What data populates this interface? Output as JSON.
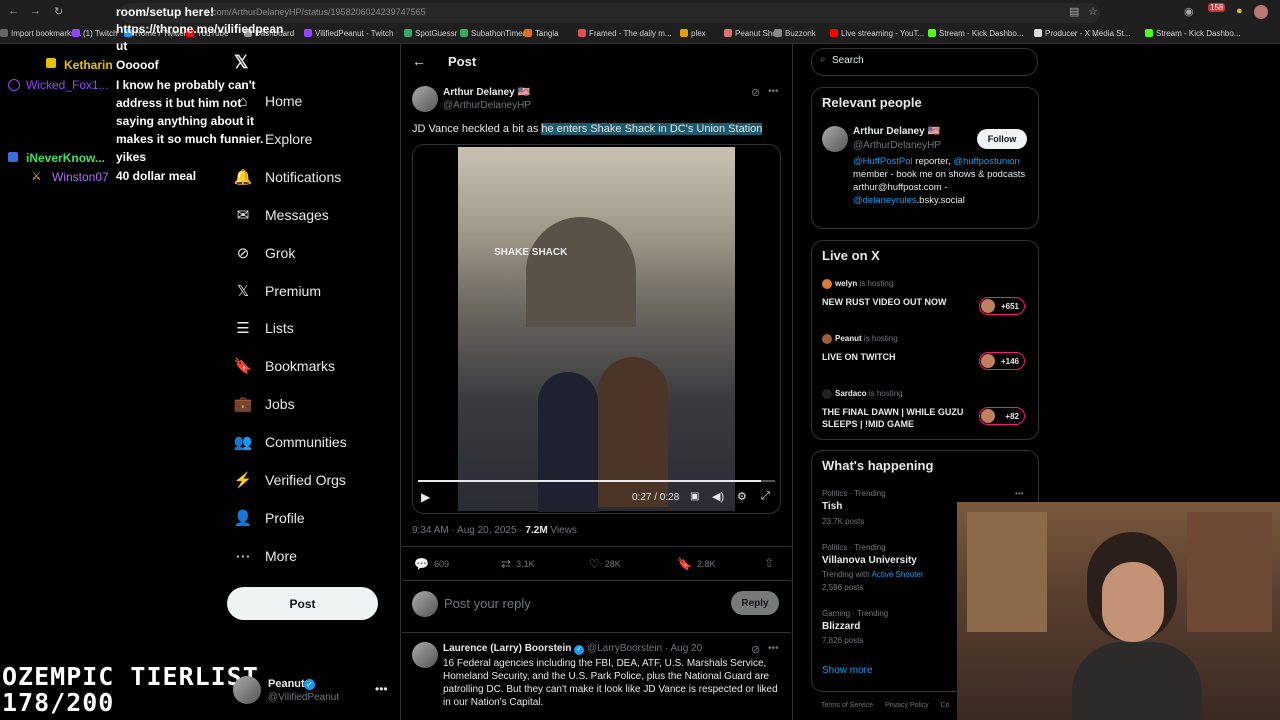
{
  "browser": {
    "url": "x.com/ArthurDelaneyHP/status/1958206024239747565",
    "bookmarks": [
      "Import bookmarks...",
      "(1) Twitch",
      "Home / Twitter",
      "YouTube",
      "Dashboard",
      "VilifiedPeanut - Twitch",
      "SpotGuessr",
      "SubathonTimer",
      "Tangia",
      "Framed - The daily m...",
      "plex",
      "Peanut Shop",
      "Buzzonk",
      "Live streaming - YouT...",
      "Stream - Kick Dashbo...",
      "Producer - X Media St...",
      "Stream - Kick Dashbo..."
    ],
    "badge": "158"
  },
  "chat": {
    "header_lines": [
      "room/setup here!",
      "https://throne.me/vilifiedpean",
      "ut"
    ],
    "messages": [
      {
        "user": "Ketharin",
        "text": "Ooooof",
        "color": "#e6c200"
      },
      {
        "user": "Wicked_Fox1...",
        "text": "I know he probably can't address it but him not saying anything about it makes it so much funnier.",
        "color": "#9147ff"
      },
      {
        "user": "iNeverKnow...",
        "text": "yikes",
        "color": "#3fe35b"
      },
      {
        "user": "Winston07",
        "text": "40 dollar meal",
        "color": "#a970ff"
      }
    ],
    "overlay_text": [
      "OZEMPIC TIERLIST",
      "178/200"
    ]
  },
  "nav": {
    "items": [
      {
        "label": "Home",
        "icon": "home-icon"
      },
      {
        "label": "Explore",
        "icon": "search-icon"
      },
      {
        "label": "Notifications",
        "icon": "bell-icon"
      },
      {
        "label": "Messages",
        "icon": "mail-icon"
      },
      {
        "label": "Grok",
        "icon": "grok-icon"
      },
      {
        "label": "Premium",
        "icon": "x-logo-icon"
      },
      {
        "label": "Lists",
        "icon": "list-icon"
      },
      {
        "label": "Bookmarks",
        "icon": "bookmark-icon"
      },
      {
        "label": "Jobs",
        "icon": "briefcase-icon"
      },
      {
        "label": "Communities",
        "icon": "people-icon"
      },
      {
        "label": "Verified Orgs",
        "icon": "lightning-icon"
      },
      {
        "label": "Profile",
        "icon": "person-icon"
      },
      {
        "label": "More",
        "icon": "more-circle-icon"
      }
    ],
    "post_label": "Post",
    "account": {
      "name": "Peanut",
      "handle": "@VilifiedPeanut"
    }
  },
  "post": {
    "header": "Post",
    "author": "Arthur Delaney",
    "flag": "🇺🇸",
    "handle": "@ArthurDelaneyHP",
    "text_before": "JD Vance heckled a bit as ",
    "text_highlight": "he enters Shake Shack in DC's Union Station",
    "video": {
      "time": "0:27 / 0:28",
      "progress": 0.96
    },
    "timestamp": "9:34 AM · Aug 20, 2025 · ",
    "views_count": "7.2M",
    "views_label": " Views",
    "stats": {
      "replies": "609",
      "reposts": "3.1K",
      "likes": "28K",
      "bookmarks": "2.8K"
    },
    "reply_placeholder": "Post your reply",
    "reply_button": "Reply"
  },
  "reply": {
    "author": "Laurence (Larry) Boorstein",
    "handle": "@LarryBoorstein",
    "date": "· Aug 20",
    "text": "16 Federal agencies including the FBI, DEA, ATF, U.S. Marshals Service, Homeland Security, and the U.S. Park Police, plus the National Guard are patrolling DC.  But they can't make it look like JD Vance is respected or liked in our Nation's Capital."
  },
  "sidebar": {
    "search_placeholder": "Search",
    "relevant": {
      "title": "Relevant people",
      "name": "Arthur Delaney",
      "handle": "@ArthurDelaneyHP",
      "follow": "Follow",
      "bio_link1": "@HuffPostPol",
      "bio1": " reporter,",
      "bio_link2": "@huffpostunion",
      "bio2": " member - book me on shows & podcasts arthur@huffpost.com - ",
      "bio_link3": "@delaneyrules",
      "bio3": ".bsky.social"
    },
    "live": {
      "title": "Live on X",
      "items": [
        {
          "host": "welyn",
          "status": "is hosting",
          "title": "NEW RUST VIDEO OUT NOW",
          "count": "+651"
        },
        {
          "host": "Peanut",
          "status": "is hosting",
          "title": "LIVE ON TWITCH",
          "count": "+146"
        },
        {
          "host": "Sardaco",
          "status": "is hosting",
          "title": "THE FINAL DAWN | WHILE GUZU SLEEPS | !MID GAME",
          "count": "+82"
        }
      ]
    },
    "happening": {
      "title": "What's happening",
      "items": [
        {
          "category": "Politics · Trending",
          "topic": "Tish",
          "sub": "23.7K posts"
        },
        {
          "category": "Politics · Trending",
          "topic": "Villanova University",
          "sub_prefix": "Trending with ",
          "sub_link": "Active Shooter",
          "sub": "2,596 posts"
        },
        {
          "category": "Gaming · Trending",
          "topic": "Blizzard",
          "sub": "7,826 posts"
        }
      ],
      "show_more": "Show more"
    },
    "footer": [
      "Terms of Service",
      "Privacy Policy",
      "Co"
    ]
  },
  "colors": {
    "accent": "#1d9bf0",
    "live_pink": "#f91880",
    "bg": "#000000",
    "border": "#2f3336"
  }
}
